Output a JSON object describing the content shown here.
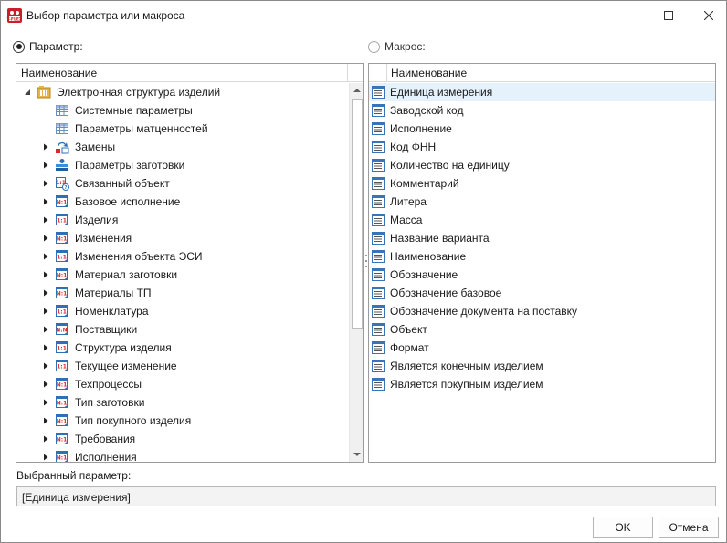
{
  "window": {
    "title": "Выбор параметра или макроса"
  },
  "mode": {
    "parameter_label": "Параметр:",
    "macro_label": "Макрос:",
    "selected": "parameter"
  },
  "left_panel": {
    "column_header": "Наименование",
    "root": {
      "label": "Электронная структура изделий",
      "icon": "folder-structure-icon",
      "expanded": true
    },
    "items": [
      {
        "label": "Системные параметры",
        "icon": "table-icon",
        "has_children": false
      },
      {
        "label": "Параметры матценностей",
        "icon": "table-icon",
        "has_children": false
      },
      {
        "label": "Замены",
        "icon": "replace-icon",
        "has_children": true
      },
      {
        "label": "Параметры заготовки",
        "icon": "stack-icon",
        "has_children": true
      },
      {
        "label": "Связанный объект",
        "icon": "linked-object-icon",
        "has_children": true
      },
      {
        "label": "Базовое исполнение",
        "icon": "relation-n1-icon",
        "has_children": true
      },
      {
        "label": "Изделия",
        "icon": "relation-11-icon",
        "has_children": true
      },
      {
        "label": "Изменения",
        "icon": "relation-n1-icon",
        "has_children": true
      },
      {
        "label": "Изменения объекта ЭСИ",
        "icon": "relation-11-icon",
        "has_children": true
      },
      {
        "label": "Материал заготовки",
        "icon": "relation-n1-icon",
        "has_children": true
      },
      {
        "label": "Материалы ТП",
        "icon": "relation-n1-icon",
        "has_children": true
      },
      {
        "label": "Номенклатура",
        "icon": "relation-11-icon",
        "has_children": true
      },
      {
        "label": "Поставщики",
        "icon": "relation-nn-icon",
        "has_children": true
      },
      {
        "label": "Структура изделия",
        "icon": "relation-11-icon",
        "has_children": true
      },
      {
        "label": "Текущее изменение",
        "icon": "relation-11-icon",
        "has_children": true
      },
      {
        "label": "Техпроцессы",
        "icon": "relation-n1-icon",
        "has_children": true
      },
      {
        "label": "Тип заготовки",
        "icon": "relation-n1-icon",
        "has_children": true
      },
      {
        "label": "Тип покупного изделия",
        "icon": "relation-n1-icon",
        "has_children": true
      },
      {
        "label": "Требования",
        "icon": "relation-n1-icon",
        "has_children": true
      },
      {
        "label": "Исполнения",
        "icon": "relation-n1-icon",
        "has_children": true
      }
    ]
  },
  "right_panel": {
    "column_header": "Наименование",
    "items": [
      {
        "label": "Единица измерения",
        "selected": true
      },
      {
        "label": "Заводской код"
      },
      {
        "label": "Исполнение"
      },
      {
        "label": "Код ФНН"
      },
      {
        "label": "Количество на единицу"
      },
      {
        "label": "Комментарий"
      },
      {
        "label": "Литера"
      },
      {
        "label": "Масса"
      },
      {
        "label": "Название варианта"
      },
      {
        "label": "Наименование"
      },
      {
        "label": "Обозначение"
      },
      {
        "label": "Обозначение базовое"
      },
      {
        "label": "Обозначение документа на поставку"
      },
      {
        "label": "Объект"
      },
      {
        "label": "Формат"
      },
      {
        "label": "Является конечным изделием"
      },
      {
        "label": "Является покупным изделием"
      }
    ]
  },
  "selected_parameter": {
    "label": "Выбранный параметр:",
    "value": "[Единица измерения]"
  },
  "buttons": {
    "ok": "OK",
    "cancel": "Отмена"
  },
  "colors": {
    "selection": "#e5f1fb",
    "icon_blue": "#2f6fb5",
    "icon_red": "#d9282f"
  }
}
